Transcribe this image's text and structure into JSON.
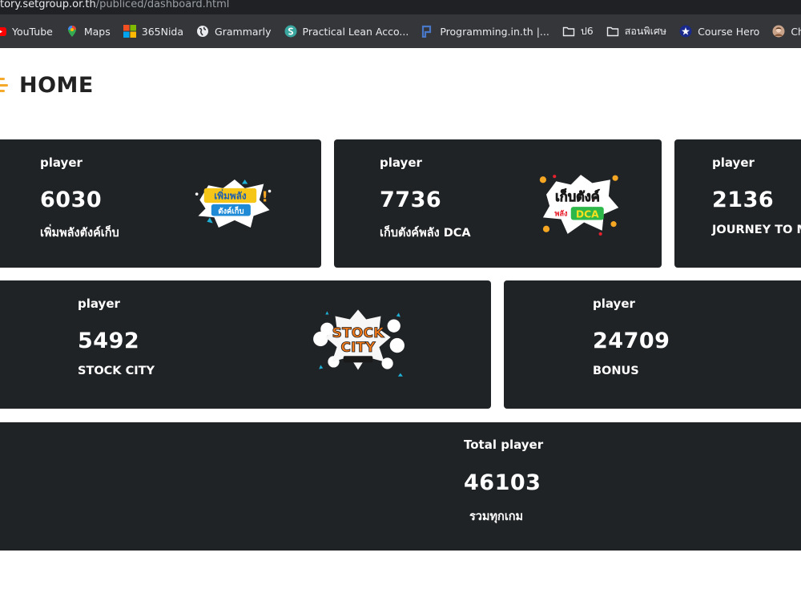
{
  "browser": {
    "url_host": "tory.setgroup.or.th",
    "url_path": "/publiced/dashboard.html",
    "bookmarks": [
      {
        "label": "YouTube",
        "icon": "youtube-icon"
      },
      {
        "label": "Maps",
        "icon": "maps-pin-icon"
      },
      {
        "label": "365Nida",
        "icon": "microsoft-icon"
      },
      {
        "label": "Grammarly",
        "icon": "globe-icon"
      },
      {
        "label": "Practical Lean Acco...",
        "icon": "s-logo-icon"
      },
      {
        "label": "Programming.in.th |...",
        "icon": "p-logo-icon"
      },
      {
        "label": "ป6",
        "icon": "folder-icon"
      },
      {
        "label": "สอนพิเศษ",
        "icon": "folder-icon"
      },
      {
        "label": "Course Hero",
        "icon": "star-badge-icon"
      },
      {
        "label": "Chloe Ting - Fla",
        "icon": "avatar-icon"
      }
    ]
  },
  "header": {
    "title": "HOME"
  },
  "cards": [
    {
      "label": "player",
      "value": "6030",
      "name": "เพิ่มพลังตังค์เก็บ",
      "logo_text": [
        "เพิ่มพลัง",
        "ตังค์เก็บ"
      ]
    },
    {
      "label": "player",
      "value": "7736",
      "name": "เก็บตังค์พลัง DCA",
      "logo_text": [
        "เก็บตังค์",
        "พลัง",
        "DCA"
      ]
    },
    {
      "label": "player",
      "value": "2136",
      "name": "JOURNEY TO MY"
    },
    {
      "label": "player",
      "value": "5492",
      "name": "STOCK CITY",
      "logo_text": [
        "STOCK",
        "CITY"
      ]
    },
    {
      "label": "player",
      "value": "24709",
      "name": "BONUS"
    }
  ],
  "total": {
    "label": "Total player",
    "value": "46103",
    "name": "รวมทุกเกม"
  },
  "colors": {
    "card_bg": "#202326",
    "bookmark_bar": "#35363a",
    "accent": "#f4a92a"
  }
}
